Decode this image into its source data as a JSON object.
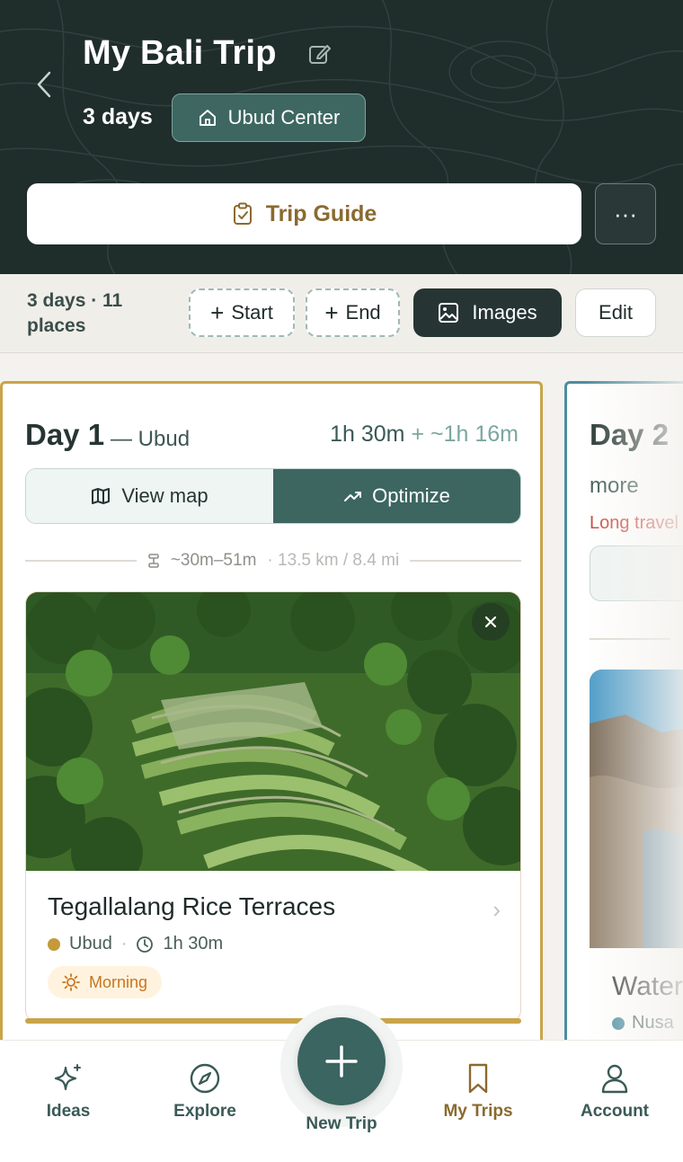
{
  "header": {
    "title": "My Bali Trip",
    "days": "3 days",
    "home_base": "Ubud Center",
    "guide_label": "Trip Guide",
    "more_label": "···"
  },
  "toolbar": {
    "summary": "3 days · 11 places",
    "start_label": "Start",
    "end_label": "End",
    "images_label": "Images",
    "edit_label": "Edit"
  },
  "day1": {
    "title": "Day 1",
    "area": "— Ubud",
    "duration": "1h 30m",
    "travel_extra": "+ ~1h 16m",
    "view_map_label": "View map",
    "optimize_label": "Optimize",
    "distance_time": "~30m–51m",
    "distance_km": "· 13.5 km / 8.4 mi",
    "place": {
      "name": "Tegallalang Rice Terraces",
      "area": "Ubud",
      "duration": "1h 30m",
      "time_of_day": "Morning"
    }
  },
  "day2": {
    "title": "Day 2",
    "more": "more",
    "warning": "Long travel",
    "place_name": "Water",
    "place_area": "Nusa"
  },
  "nav": {
    "ideas": "Ideas",
    "explore": "Explore",
    "new_trip": "New Trip",
    "my_trips": "My Trips",
    "account": "Account"
  },
  "colors": {
    "header_bg": "#1f2d2b",
    "accent_teal": "#3d6661",
    "gold": "#c9a44a",
    "day2_blue": "#4b8da0",
    "warning_red": "#c6433a"
  }
}
